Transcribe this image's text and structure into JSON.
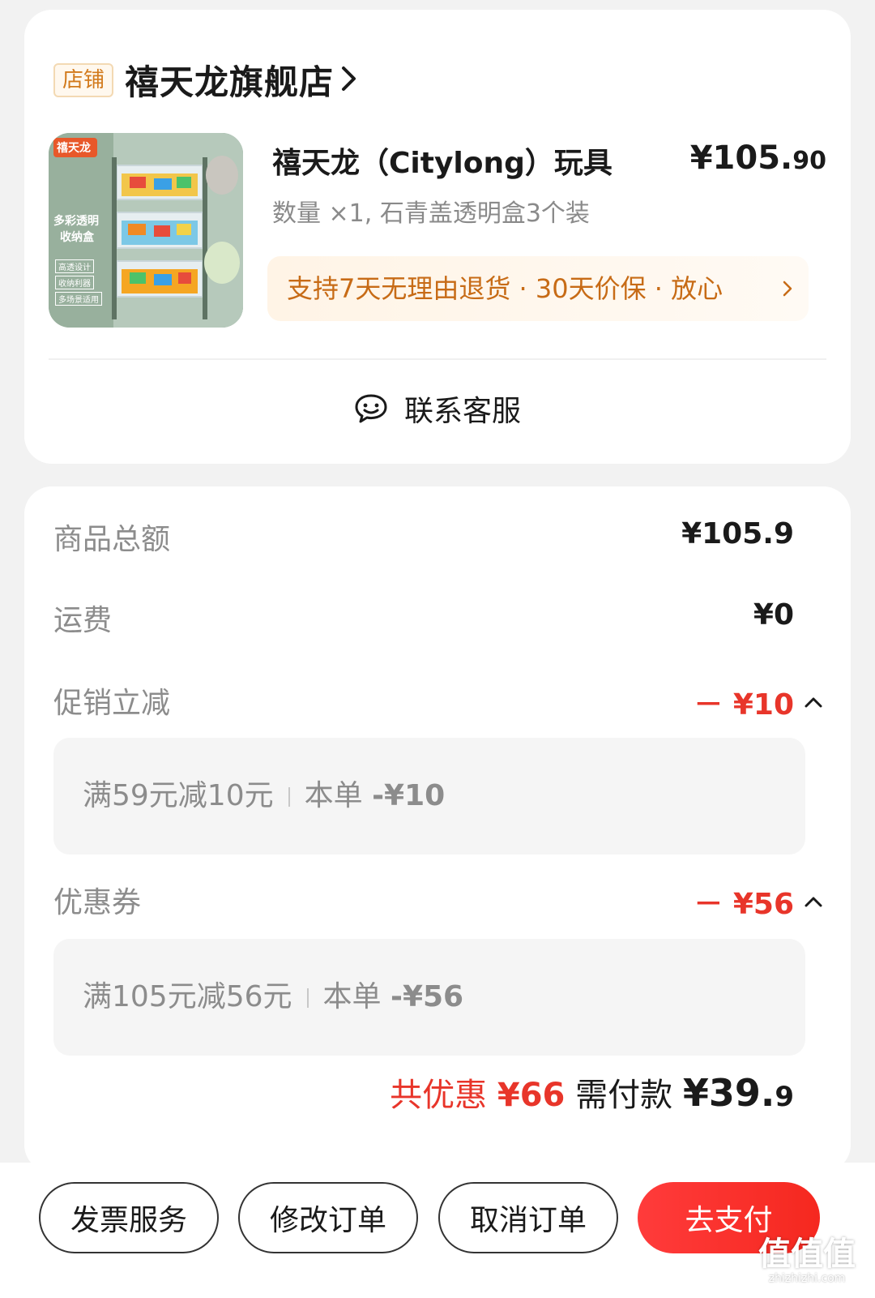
{
  "shop": {
    "tag": "店铺",
    "name": "禧天龙旗舰店"
  },
  "product": {
    "title": "禧天龙（Citylong）玩具",
    "price_int": "¥105.",
    "price_cents": "90",
    "spec": "数量 ×1, 石青盖透明盒3个装",
    "image_brand": "禧天龙",
    "image_caption_1": "多彩透明",
    "image_caption_2": "收纳盒",
    "image_tags": [
      "高透设计",
      "收纳利器",
      "多场景适用"
    ],
    "guarantee": "支持7天无理由退货 · 30天价保 · 放心"
  },
  "contact": {
    "label": "联系客服"
  },
  "summary": {
    "subtotal_label": "商品总额",
    "subtotal_value": "¥105.9",
    "shipping_label": "运费",
    "shipping_value": "¥0",
    "promo_label": "促销立减",
    "promo_value": "－ ¥10",
    "promo_detail_rule": "满59元减10元",
    "promo_detail_this": "本单",
    "promo_detail_amount": "-¥10",
    "coupon_label": "优惠券",
    "coupon_value": "－ ¥56",
    "coupon_detail_rule": "满105元减56元",
    "coupon_detail_this": "本单",
    "coupon_detail_amount": "-¥56",
    "total_discount_label": "共优惠",
    "total_discount_value": "¥66",
    "payable_label": "需付款",
    "payable_int": "¥39.",
    "payable_cents": "9"
  },
  "actions": {
    "invoice": "发票服务",
    "modify": "修改订单",
    "cancel": "取消订单",
    "pay": "去支付"
  },
  "watermark": {
    "logo": "值值值",
    "url": "zhizhizhi.com"
  },
  "colors": {
    "accent_red": "#e8352a",
    "guarantee_orange": "#c76b16",
    "tag_orange": "#d27a1c"
  }
}
